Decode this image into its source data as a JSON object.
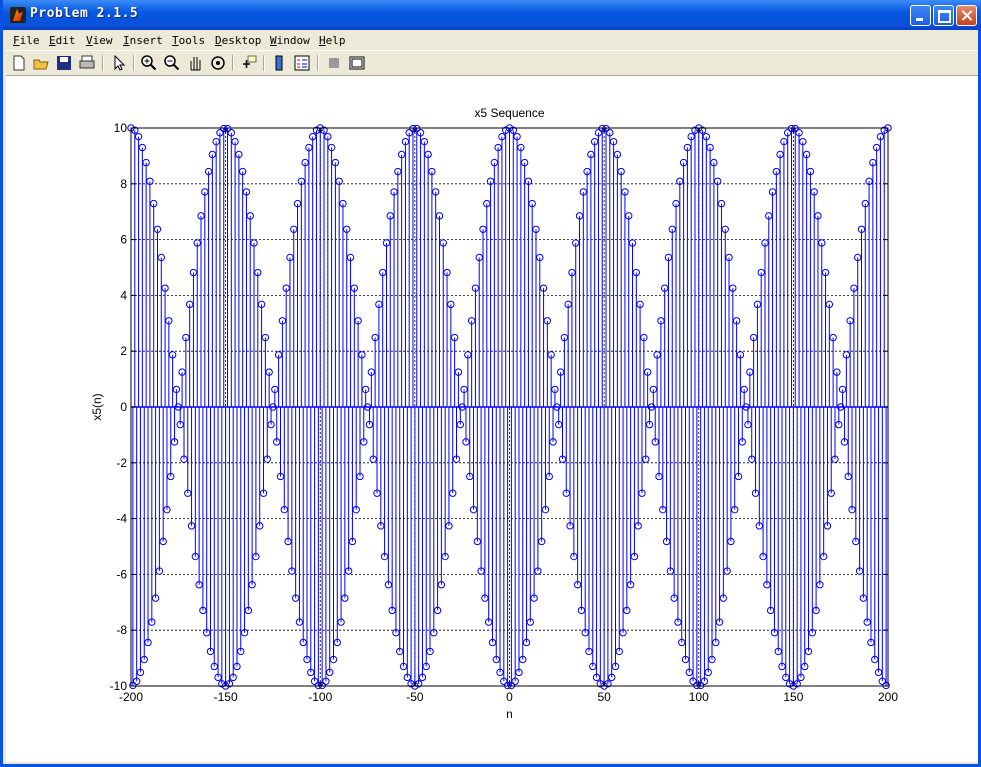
{
  "window": {
    "title": "Problem 2.1.5"
  },
  "menu": [
    "File",
    "Edit",
    "View",
    "Insert",
    "Tools",
    "Desktop",
    "Window",
    "Help"
  ],
  "toolbar": [
    "new-icon",
    "open-icon",
    "save-icon",
    "print-icon",
    "pointer-icon",
    "zoom-in-icon",
    "zoom-out-icon",
    "pan-icon",
    "rotate-icon",
    "data-cursor-icon",
    "colorbar-icon",
    "legend-icon",
    "hide-plot-tools-icon",
    "show-plot-tools-icon"
  ],
  "colors": {
    "stem": "#0000ff"
  },
  "chart_data": {
    "type": "stem",
    "title": "x5 Sequence",
    "xlabel": "n",
    "ylabel": "x5(n)",
    "xlim": [
      -200,
      200
    ],
    "ylim": [
      -10,
      10
    ],
    "xticks": [
      "-200",
      "-150",
      "-100",
      "-50",
      "0",
      "50",
      "100",
      "150",
      "200"
    ],
    "yticks": [
      "-10",
      "-8",
      "-6",
      "-4",
      "-2",
      "0",
      "2",
      "4",
      "6",
      "8",
      "10"
    ],
    "grid": true,
    "series": [
      {
        "x": [
          -200,
          -198,
          -196,
          -194,
          -192,
          -190,
          -188,
          -186,
          -184,
          -182,
          -180,
          -178,
          -176,
          -174,
          -172,
          -170,
          -168,
          -166,
          -164,
          -162,
          -160,
          -158,
          -156,
          -154,
          -152,
          -150,
          -148,
          -146,
          -144,
          -142,
          -140,
          -138,
          -136,
          -134,
          -132,
          -130,
          -128,
          -126,
          -124,
          -122,
          -120,
          -118,
          -116,
          -114,
          -112,
          -110,
          -108,
          -106,
          -104,
          -102,
          -100,
          -98,
          -96,
          -94,
          -92,
          -90,
          -88,
          -86,
          -84,
          -82,
          -80,
          -78,
          -76,
          -74,
          -72,
          -70,
          -68,
          -66,
          -64,
          -62,
          -60,
          -58,
          -56,
          -54,
          -52,
          -50,
          -48,
          -46,
          -44,
          -42,
          -40,
          -38,
          -36,
          -34,
          -32,
          -30,
          -28,
          -26,
          -24,
          -22,
          -20,
          -18,
          -16,
          -14,
          -12,
          -10,
          -8,
          -6,
          -4,
          -2,
          0,
          2,
          4,
          6,
          8,
          10,
          12,
          14,
          16,
          18,
          20,
          22,
          24,
          26,
          28,
          30,
          32,
          34,
          36,
          38,
          40,
          42,
          44,
          46,
          48,
          50,
          52,
          54,
          56,
          58,
          60,
          62,
          64,
          66,
          68,
          70,
          72,
          74,
          76,
          78,
          80,
          82,
          84,
          86,
          88,
          90,
          92,
          94,
          96,
          98,
          100,
          102,
          104,
          106,
          108,
          110,
          112,
          114,
          116,
          118,
          120,
          122,
          124,
          126,
          128,
          130,
          132,
          134,
          136,
          138,
          140,
          142,
          144,
          146,
          148,
          150,
          152,
          154,
          156,
          158,
          160,
          162,
          164,
          166,
          168,
          170,
          172,
          174,
          176,
          178,
          180,
          182,
          184,
          186,
          188,
          190,
          192,
          194,
          196,
          198,
          200
        ],
        "y": [
          10,
          9.92,
          9.69,
          9.3,
          8.76,
          8.09,
          7.29,
          6.37,
          5.36,
          4.26,
          3.09,
          1.87,
          0.63,
          -0.63,
          -1.87,
          -3.09,
          -4.26,
          -5.36,
          -6.37,
          -7.29,
          -8.09,
          -8.76,
          -9.3,
          -9.69,
          -9.92,
          -10,
          -9.92,
          -9.69,
          -9.3,
          -8.76,
          -8.09,
          -7.29,
          -6.37,
          -5.36,
          -4.26,
          -3.09,
          -1.87,
          -0.63,
          0.63,
          1.87,
          3.09,
          4.26,
          5.36,
          6.37,
          7.29,
          8.09,
          8.76,
          9.3,
          9.69,
          9.92,
          10,
          9.92,
          9.69,
          9.3,
          8.76,
          8.09,
          7.29,
          6.37,
          5.36,
          4.26,
          3.09,
          1.87,
          0.63,
          -0.63,
          -1.87,
          -3.09,
          -4.26,
          -5.36,
          -6.37,
          -7.29,
          -8.09,
          -8.76,
          -9.3,
          -9.69,
          -9.92,
          -10,
          -9.92,
          -9.69,
          -9.3,
          -8.76,
          -8.09,
          -7.29,
          -6.37,
          -5.36,
          -4.26,
          -3.09,
          -1.87,
          -0.63,
          0.63,
          1.87,
          3.09,
          4.26,
          5.36,
          6.37,
          7.29,
          8.09,
          8.76,
          9.3,
          9.69,
          9.92,
          10,
          9.92,
          9.69,
          9.3,
          8.76,
          8.09,
          7.29,
          6.37,
          5.36,
          4.26,
          3.09,
          1.87,
          0.63,
          -0.63,
          -1.87,
          -3.09,
          -4.26,
          -5.36,
          -6.37,
          -7.29,
          -8.09,
          -8.76,
          -9.3,
          -9.69,
          -9.92,
          -10,
          -9.92,
          -9.69,
          -9.3,
          -8.76,
          -8.09,
          -7.29,
          -6.37,
          -5.36,
          -4.26,
          -3.09,
          -1.87,
          -0.63,
          0.63,
          1.87,
          3.09,
          4.26,
          5.36,
          6.37,
          7.29,
          8.09,
          8.76,
          9.3,
          9.69,
          9.92,
          10,
          9.92,
          9.69,
          9.3,
          8.76,
          8.09,
          7.29,
          6.37,
          5.36,
          4.26,
          3.09,
          1.87,
          0.63,
          -0.63,
          -1.87,
          -3.09,
          -4.26,
          -5.36,
          -6.37,
          -7.29,
          -8.09,
          -8.76,
          -9.3,
          -9.69,
          -9.92,
          -10,
          -9.92,
          -9.69,
          -9.3,
          -8.76,
          -8.09,
          -7.29,
          -6.37,
          -5.36,
          -4.26,
          -3.09,
          -1.87,
          -0.63,
          0.63,
          1.87,
          3.09,
          4.26,
          5.36,
          6.37,
          7.29,
          8.09,
          8.76,
          9.3,
          9.69,
          9.92,
          10
        ]
      },
      {
        "x": [
          -199,
          -197,
          -195,
          -193,
          -191,
          -189,
          -187,
          -185,
          -183,
          -181,
          -179,
          -177,
          -175,
          -173,
          -171,
          -169,
          -167,
          -165,
          -163,
          -161,
          -159,
          -157,
          -155,
          -153,
          -151,
          -149,
          -147,
          -145,
          -143,
          -141,
          -139,
          -137,
          -135,
          -133,
          -131,
          -129,
          -127,
          -125,
          -123,
          -121,
          -119,
          -117,
          -115,
          -113,
          -111,
          -109,
          -107,
          -105,
          -103,
          -101,
          -99,
          -97,
          -95,
          -93,
          -91,
          -89,
          -87,
          -85,
          -83,
          -81,
          -79,
          -77,
          -75,
          -73,
          -71,
          -69,
          -67,
          -65,
          -63,
          -61,
          -59,
          -57,
          -55,
          -53,
          -51,
          -49,
          -47,
          -45,
          -43,
          -41,
          -39,
          -37,
          -35,
          -33,
          -31,
          -29,
          -27,
          -25,
          -23,
          -21,
          -19,
          -17,
          -15,
          -13,
          -11,
          -9,
          -7,
          -5,
          -3,
          -1,
          1,
          3,
          5,
          7,
          9,
          11,
          13,
          15,
          17,
          19,
          21,
          23,
          25,
          27,
          29,
          31,
          33,
          35,
          37,
          39,
          41,
          43,
          45,
          47,
          49,
          51,
          53,
          55,
          57,
          59,
          61,
          63,
          65,
          67,
          69,
          71,
          73,
          75,
          77,
          79,
          81,
          83,
          85,
          87,
          89,
          91,
          93,
          95,
          97,
          99,
          101,
          103,
          105,
          107,
          109,
          111,
          113,
          115,
          117,
          119,
          121,
          123,
          125,
          127,
          129,
          131,
          133,
          135,
          137,
          139,
          141,
          143,
          145,
          147,
          149,
          151,
          153,
          155,
          157,
          159,
          161,
          163,
          165,
          167,
          169,
          171,
          173,
          175,
          177,
          179,
          181,
          183,
          185,
          187,
          189,
          191,
          193,
          195,
          197,
          199
        ],
        "y": [
          -9.98,
          -9.83,
          -9.51,
          -9.05,
          -8.44,
          -7.71,
          -6.85,
          -5.88,
          -4.82,
          -3.68,
          -2.49,
          -1.25,
          0,
          1.25,
          2.49,
          3.68,
          4.82,
          5.88,
          6.85,
          7.71,
          8.44,
          9.05,
          9.51,
          9.83,
          9.98,
          9.98,
          9.83,
          9.51,
          9.05,
          8.44,
          7.71,
          6.85,
          5.88,
          4.82,
          3.68,
          2.49,
          1.25,
          0,
          -1.25,
          -2.49,
          -3.68,
          -4.82,
          -5.88,
          -6.85,
          -7.71,
          -8.44,
          -9.05,
          -9.51,
          -9.83,
          -9.98,
          -9.98,
          -9.83,
          -9.51,
          -9.05,
          -8.44,
          -7.71,
          -6.85,
          -5.88,
          -4.82,
          -3.68,
          -2.49,
          -1.25,
          0,
          1.25,
          2.49,
          3.68,
          4.82,
          5.88,
          6.85,
          7.71,
          8.44,
          9.05,
          9.51,
          9.83,
          9.98,
          9.98,
          9.83,
          9.51,
          9.05,
          8.44,
          7.71,
          6.85,
          5.88,
          4.82,
          3.68,
          2.49,
          1.25,
          0,
          -1.25,
          -2.49,
          -3.68,
          -4.82,
          -5.88,
          -6.85,
          -7.71,
          -8.44,
          -9.05,
          -9.51,
          -9.83,
          -9.98,
          -9.98,
          -9.83,
          -9.51,
          -9.05,
          -8.44,
          -7.71,
          -6.85,
          -5.88,
          -4.82,
          -3.68,
          -2.49,
          -1.25,
          0,
          1.25,
          2.49,
          3.68,
          4.82,
          5.88,
          6.85,
          7.71,
          8.44,
          9.05,
          9.51,
          9.83,
          9.98,
          9.98,
          9.83,
          9.51,
          9.05,
          8.44,
          7.71,
          6.85,
          5.88,
          4.82,
          3.68,
          2.49,
          1.25,
          0,
          -1.25,
          -2.49,
          -3.68,
          -4.82,
          -5.88,
          -6.85,
          -7.71,
          -8.44,
          -9.05,
          -9.51,
          -9.83,
          -9.98,
          -9.98,
          -9.83,
          -9.51,
          -9.05,
          -8.44,
          -7.71,
          -6.85,
          -5.88,
          -4.82,
          -3.68,
          -2.49,
          -1.25,
          0,
          1.25,
          2.49,
          3.68,
          4.82,
          5.88,
          6.85,
          7.71,
          8.44,
          9.05,
          9.51,
          9.83,
          9.98,
          9.98,
          9.83,
          9.51,
          9.05,
          8.44,
          7.71,
          6.85,
          5.88,
          4.82,
          3.68,
          2.49,
          1.25,
          0,
          -1.25,
          -2.49,
          -3.68,
          -4.82,
          -5.88,
          -6.85,
          -7.71,
          -8.44,
          -9.05,
          -9.51,
          -9.83,
          -9.98
        ]
      }
    ]
  }
}
